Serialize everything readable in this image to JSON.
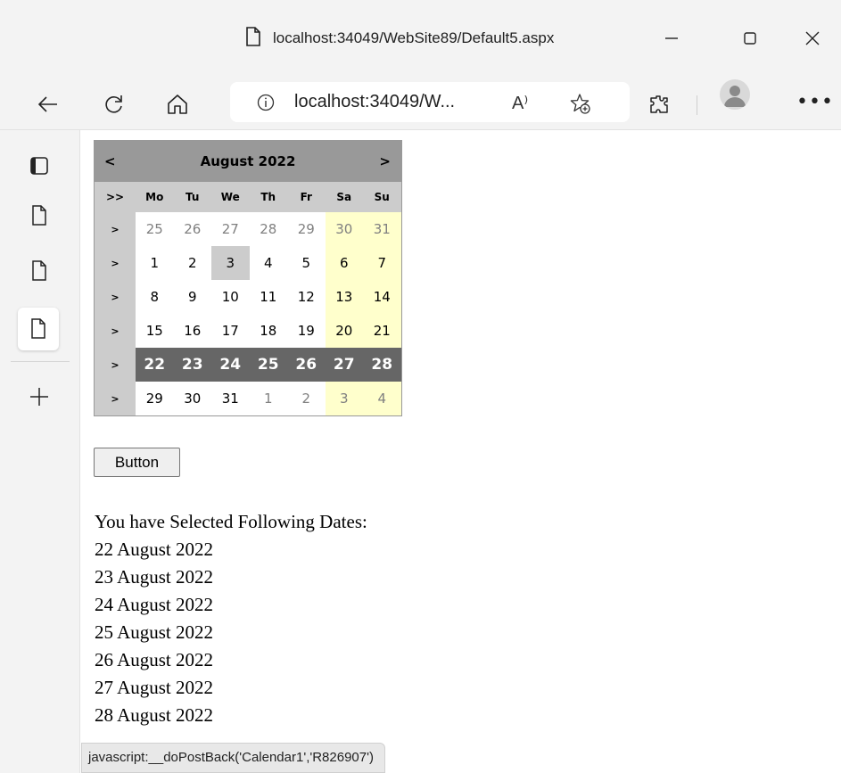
{
  "window": {
    "title": "localhost:34049/WebSite89/Default5.aspx"
  },
  "toolbar": {
    "url": "localhost:34049/W...",
    "read_aloud": "A⁾"
  },
  "calendar": {
    "prev_label": "<",
    "next_label": ">",
    "month_title": "August 2022",
    "month_selector": ">>",
    "week_selector": ">",
    "day_headers": [
      "Mo",
      "Tu",
      "We",
      "Th",
      "Fr",
      "Sa",
      "Su"
    ],
    "weeks": [
      [
        "25",
        "26",
        "27",
        "28",
        "29",
        "30",
        "31"
      ],
      [
        "1",
        "2",
        "3",
        "4",
        "5",
        "6",
        "7"
      ],
      [
        "8",
        "9",
        "10",
        "11",
        "12",
        "13",
        "14"
      ],
      [
        "15",
        "16",
        "17",
        "18",
        "19",
        "20",
        "21"
      ],
      [
        "22",
        "23",
        "24",
        "25",
        "26",
        "27",
        "28"
      ],
      [
        "29",
        "30",
        "31",
        "1",
        "2",
        "3",
        "4"
      ]
    ],
    "colors": {
      "title_bg": "#999999",
      "header_bg": "#cccccc",
      "weekend_bg": "#ffffcc",
      "selected_bg": "#666666",
      "other_month_fg": "#808080"
    }
  },
  "button": {
    "label": "Button"
  },
  "results": {
    "heading": "You have Selected Following Dates:",
    "dates": [
      "22 August 2022",
      "23 August 2022",
      "24 August 2022",
      "25 August 2022",
      "26 August 2022",
      "27 August 2022",
      "28 August 2022"
    ]
  },
  "status_bar": {
    "text": "javascript:__doPostBack('Calendar1','R826907')"
  },
  "icons": {
    "back": "back-arrow-icon",
    "refresh": "refresh-icon",
    "home": "home-icon",
    "info": "info-icon",
    "favorites": "add-favorite-icon",
    "extensions": "extensions-icon",
    "profile": "profile-avatar-icon",
    "more": "more-options-icon",
    "tab_actions": "tab-actions-icon",
    "tab": "tab-page-icon",
    "new_tab": "new-tab-icon"
  }
}
